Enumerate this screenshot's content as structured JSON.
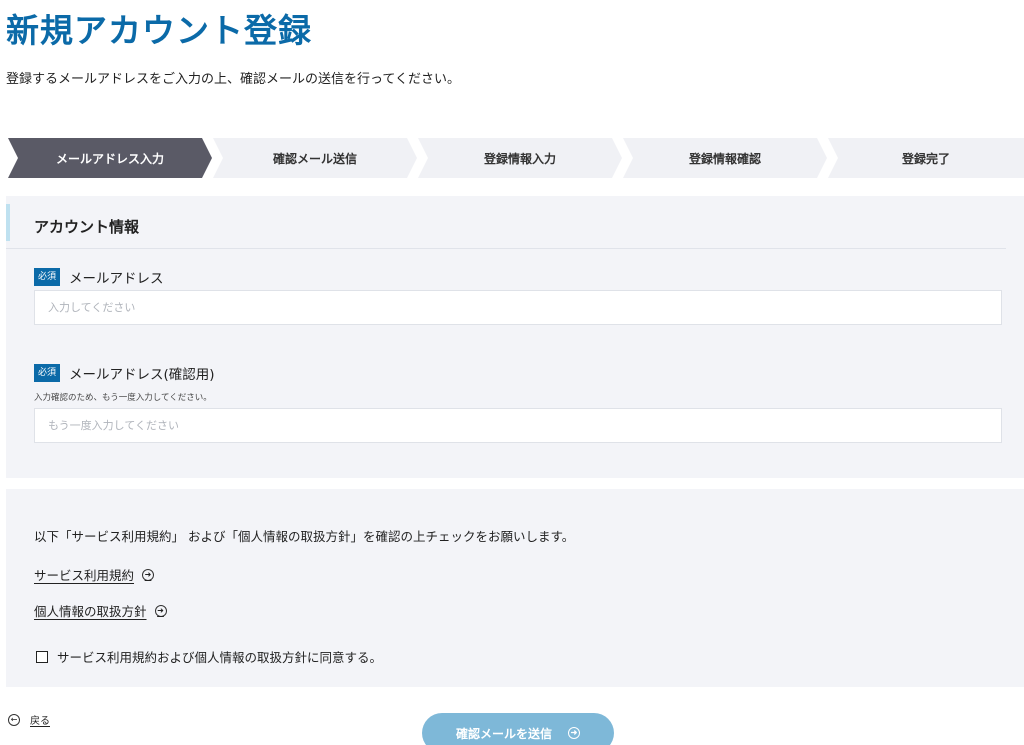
{
  "page": {
    "title": "新規アカウント登録",
    "lead": "登録するメールアドレスをご入力の上、確認メールの送信を行ってください。"
  },
  "steps": [
    {
      "label": "メールアドレス入力",
      "active": true
    },
    {
      "label": "確認メール送信",
      "active": false
    },
    {
      "label": "登録情報入力",
      "active": false
    },
    {
      "label": "登録情報確認",
      "active": false
    },
    {
      "label": "登録完了",
      "active": false
    }
  ],
  "colors": {
    "brand": "#0b6aa8",
    "step_active": "#5a5a66",
    "step_inactive": "#f0f1f5",
    "section_bg": "#f3f4f8",
    "submit_bg": "#7eb8d8"
  },
  "account": {
    "heading": "アカウント情報",
    "required_badge": "必須",
    "email": {
      "label": "メールアドレス",
      "placeholder": "入力してください",
      "value": ""
    },
    "email_confirm": {
      "label": "メールアドレス(確認用)",
      "hint": "入力確認のため、もう一度入力してください。",
      "placeholder": "もう一度入力してください",
      "value": ""
    }
  },
  "terms": {
    "text": "以下「サービス利用規約」 および「個人情報の取扱方針」を確認の上チェックをお願いします。",
    "links": [
      "サービス利用規約",
      "個人情報の取扱方針"
    ],
    "agree_label": "サービス利用規約および個人情報の取扱方針に同意する。",
    "agree_checked": false,
    "link_icon": "arrow-circle-right-icon"
  },
  "actions": {
    "back_label": "戻る",
    "back_icon": "arrow-circle-left-icon",
    "submit_label": "確認メールを送信",
    "submit_icon": "arrow-circle-right-icon"
  }
}
